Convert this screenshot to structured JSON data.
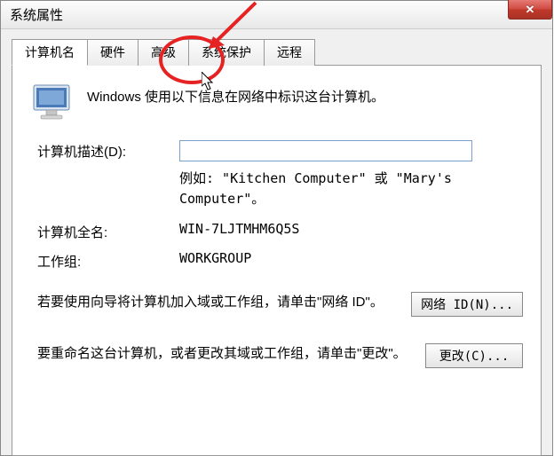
{
  "window": {
    "title": "系统属性"
  },
  "tabs": {
    "computer_name": "计算机名",
    "hardware": "硬件",
    "advanced": "高级",
    "system_protection": "系统保护",
    "remote": "远程"
  },
  "intro": "Windows 使用以下信息在网络中标识这台计算机。",
  "form": {
    "desc_label": "计算机描述(D):",
    "desc_value": "",
    "example": "例如: \"Kitchen Computer\" 或 \"Mary's Computer\"。",
    "fullname_label": "计算机全名:",
    "fullname_value": "WIN-7LJTMHM6Q5S",
    "workgroup_label": "工作组:",
    "workgroup_value": "WORKGROUP"
  },
  "sections": {
    "network_id_text": "若要使用向导将计算机加入域或工作组，请单击\"网络 ID\"。",
    "network_id_btn": "网络 ID(N)...",
    "change_text": "要重命名这台计算机，或者更改其域或工作组，请单击\"更改\"。",
    "change_btn": "更改(C)..."
  }
}
